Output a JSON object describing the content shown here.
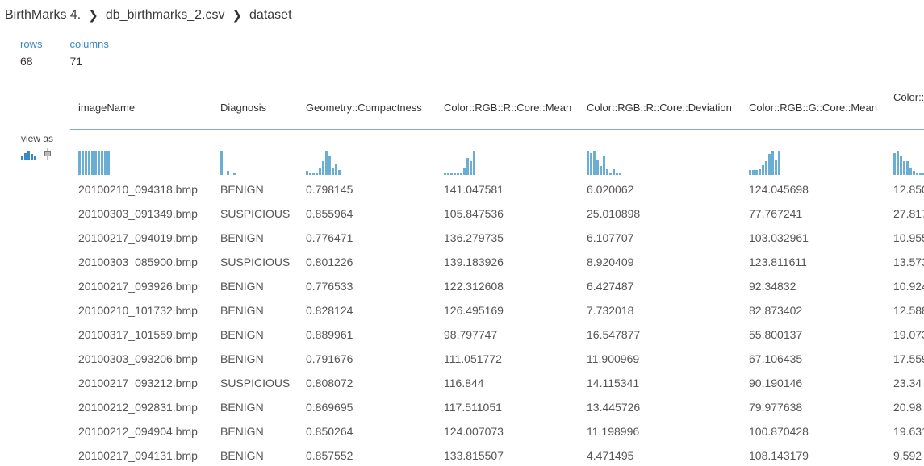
{
  "breadcrumb": {
    "items": [
      "BirthMarks 4.",
      "db_birthmarks_2.csv",
      "dataset"
    ]
  },
  "stats": {
    "rows_label": "rows",
    "rows_value": "68",
    "columns_label": "columns",
    "columns_value": "71"
  },
  "view_as": {
    "label": "view as",
    "options": [
      "histogram-icon",
      "boxplot-icon"
    ]
  },
  "colors": {
    "accent": "#3b88c6",
    "histogram_bar": "#6aaed4",
    "header_rule": "#7aaed0"
  },
  "table": {
    "columns": [
      "imageName",
      "Diagnosis",
      "Geometry::Compactness",
      "Color::RGB::R::Core::Mean",
      "Color::RGB::R::Core::Deviation",
      "Color::RGB::G::Core::Mean",
      "Color::RGB::G::Core::Deviation"
    ],
    "histograms": [
      [
        1,
        1,
        1,
        1,
        1,
        1,
        1,
        1,
        1,
        1
      ],
      [
        1,
        0,
        0.15,
        0,
        0.06
      ],
      [
        0.15,
        0.05,
        0.1,
        0.1,
        0.3,
        0.55,
        1,
        0.75,
        0.3,
        0.45,
        0.2
      ],
      [
        0.05,
        0.05,
        0.05,
        0.05,
        0.1,
        0.1,
        0.3,
        0.7,
        0.55,
        1
      ],
      [
        1,
        0.9,
        1,
        0.6,
        0.35,
        0.75,
        0.25,
        0.1,
        0.25,
        0.1,
        0.1
      ],
      [
        0.2,
        0.2,
        0.2,
        0.25,
        0.4,
        0.55,
        0.85,
        1,
        0.6,
        1
      ],
      [
        0.9,
        1,
        0.75,
        0.55,
        0.55,
        0.3,
        0.15,
        0.1,
        0.1,
        0.05
      ]
    ],
    "rows": [
      [
        "20100210_094318.bmp",
        "BENIGN",
        "0.798145",
        "141.047581",
        "6.020062",
        "124.045698",
        "12.850"
      ],
      [
        "20100303_091349.bmp",
        "SUSPICIOUS",
        "0.855964",
        "105.847536",
        "25.010898",
        "77.767241",
        "27.817"
      ],
      [
        "20100217_094019.bmp",
        "BENIGN",
        "0.776471",
        "136.279735",
        "6.107707",
        "103.032961",
        "10.955"
      ],
      [
        "20100303_085900.bmp",
        "SUSPICIOUS",
        "0.801226",
        "139.183926",
        "8.920409",
        "123.811611",
        "13.573"
      ],
      [
        "20100217_093926.bmp",
        "BENIGN",
        "0.776533",
        "122.312608",
        "6.427487",
        "92.34832",
        "10.924"
      ],
      [
        "20100210_101732.bmp",
        "BENIGN",
        "0.828124",
        "126.495169",
        "7.732018",
        "82.873402",
        "12.588"
      ],
      [
        "20100317_101559.bmp",
        "BENIGN",
        "0.889961",
        "98.797747",
        "16.547877",
        "55.800137",
        "19.073"
      ],
      [
        "20100303_093206.bmp",
        "BENIGN",
        "0.791676",
        "111.051772",
        "11.900969",
        "67.106435",
        "17.559"
      ],
      [
        "20100217_093212.bmp",
        "SUSPICIOUS",
        "0.808072",
        "116.844",
        "14.115341",
        "90.190146",
        "23.34"
      ],
      [
        "20100212_092831.bmp",
        "BENIGN",
        "0.869695",
        "117.511051",
        "13.445726",
        "79.977638",
        "20.98"
      ],
      [
        "20100212_094904.bmp",
        "BENIGN",
        "0.850264",
        "124.007073",
        "11.198996",
        "100.870428",
        "19.631"
      ],
      [
        "20100217_094131.bmp",
        "BENIGN",
        "0.857552",
        "133.815507",
        "4.471495",
        "108.143179",
        "9.592"
      ]
    ]
  }
}
